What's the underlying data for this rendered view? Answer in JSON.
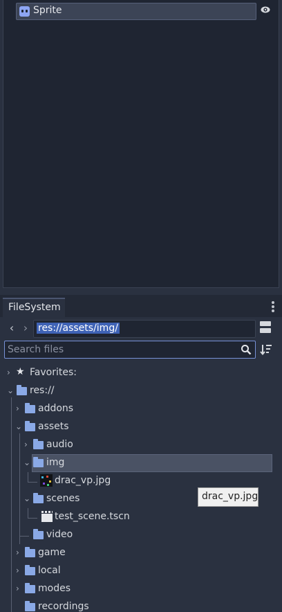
{
  "scene_tree": {
    "node_label": "Sprite",
    "node_icon": "sprite-node-icon",
    "visibility_icon": "eye-icon"
  },
  "filesystem": {
    "tab_label": "FileSystem",
    "path": "res://assets/img/",
    "search_placeholder": "Search files",
    "tree": {
      "favorites": "Favorites:",
      "res": "res://",
      "addons": "addons",
      "assets": "assets",
      "audio": "audio",
      "img": "img",
      "drac_vp": "drac_vp.jpg",
      "scenes": "scenes",
      "test_scene": "test_scene.tscn",
      "video": "video",
      "game": "game",
      "local": "local",
      "modes": "modes",
      "recordings": "recordings"
    },
    "tooltip": "drac_vp.jpg"
  },
  "colors": {
    "panel_bg": "#1f2532",
    "folder": "#8aa9e6",
    "accent": "#7892d8",
    "selection": "#4a5264"
  }
}
